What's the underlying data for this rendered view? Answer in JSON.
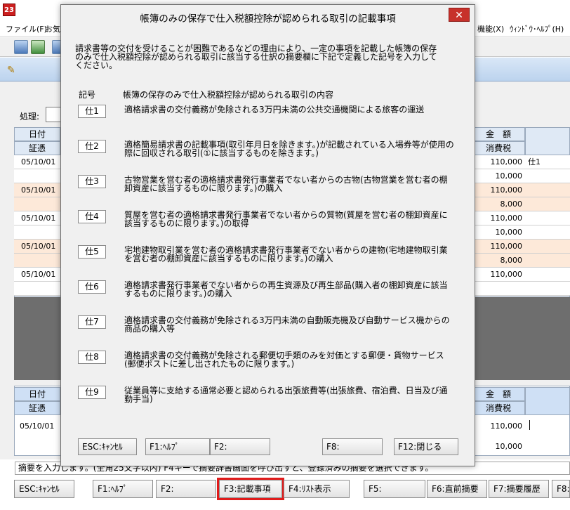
{
  "app": {
    "icon_text": "23",
    "menu": [
      "ファイル(F)",
      "お気",
      "機能(X)",
      "ｳｨﾝﾄﾞｳ･ﾍﾙﾌﾟ(H)"
    ]
  },
  "background": {
    "process_label": "処理:",
    "grid_top": {
      "headers_left": [
        "日付",
        "証憑"
      ],
      "headers_right": [
        "金　額",
        "消費税"
      ],
      "rows": [
        {
          "date": "05/10/01",
          "amount": "110,000",
          "extra": "仕1",
          "style": "white"
        },
        {
          "date": "",
          "amount": "10,000",
          "extra": "",
          "style": "white"
        },
        {
          "date": "05/10/01",
          "amount": "110,000",
          "extra": "",
          "style": "peach"
        },
        {
          "date": "",
          "amount": "8,000",
          "extra": "",
          "style": "peach"
        },
        {
          "date": "05/10/01",
          "amount": "110,000",
          "extra": "",
          "style": "white"
        },
        {
          "date": "",
          "amount": "10,000",
          "extra": "",
          "style": "white"
        },
        {
          "date": "05/10/01",
          "amount": "110,000",
          "extra": "",
          "style": "peach"
        },
        {
          "date": "",
          "amount": "8,000",
          "extra": "",
          "style": "peach"
        },
        {
          "date": "05/10/01",
          "amount": "110,000",
          "extra": "",
          "style": "white"
        },
        {
          "date": "",
          "amount": "",
          "extra": "",
          "style": "white"
        }
      ]
    },
    "grid_bottom": {
      "headers_left": [
        "日付",
        "証憑"
      ],
      "headers_right": [
        "金　額",
        "消費税"
      ],
      "rows": [
        {
          "date": "05/10/01",
          "amount": "110,000"
        },
        {
          "date": "",
          "amount": "10,000"
        }
      ]
    },
    "hint": "摘要を入力します。(全角25文字以内) F4キーで摘要辞書画面を呼び出すと、登録済みの摘要を選択できます。",
    "function_keys": [
      "ESC:ｷｬﾝｾﾙ",
      "F1:ﾍﾙﾌﾟ",
      "F2:",
      "F3:記載事項",
      "F4:ﾘｽﾄ表示",
      "F5:",
      "F6:直前摘要",
      "F7:摘要履歴",
      "F8:"
    ]
  },
  "dialog": {
    "title": "帳簿のみの保存で仕入税額控除が認められる取引の記載事項",
    "close": "✕",
    "intro": "請求書等の交付を受けることが困難であるなどの理由により、一定の事項を記載した帳簿の保存のみで仕入税額控除が認められる取引に該当する仕訳の摘要欄に下記で定義した記号を入力してください。",
    "header_code": "記号",
    "header_content": "帳簿の保存のみで仕入税額控除が認められる取引の内容",
    "rules": [
      {
        "code": "仕1",
        "text": "適格請求書の交付義務が免除される3万円未満の公共交通機関による旅客の運送"
      },
      {
        "code": "仕2",
        "text": "適格簡易請求書の記載事項(取引年月日を除きます。)が記載されている入場券等が使用の際に回収される取引(①に該当するものを除きます。)"
      },
      {
        "code": "仕3",
        "text": "古物営業を営む者の適格請求書発行事業者でない者からの古物(古物営業を営む者の棚卸資産に該当するものに限ります。)の購入"
      },
      {
        "code": "仕4",
        "text": "質屋を営む者の適格請求書発行事業者でない者からの質物(質屋を営む者の棚卸資産に該当するものに限ります。)の取得"
      },
      {
        "code": "仕5",
        "text": "宅地建物取引業を営む者の適格請求書発行事業者でない者からの建物(宅地建物取引業を営む者の棚卸資産に該当するものに限ります。)の購入"
      },
      {
        "code": "仕6",
        "text": "適格請求書発行事業者でない者からの再生資源及び再生部品(購入者の棚卸資産に該当するものに限ります。)の購入"
      },
      {
        "code": "仕7",
        "text": "適格請求書の交付義務が免除される3万円未満の自動販売機及び自動サービス機からの商品の購入等"
      },
      {
        "code": "仕8",
        "text": "適格請求書の交付義務が免除される郵便切手類のみを対価とする郵便・貨物サービス(郵便ポストに差し出されたものに限ります。)"
      },
      {
        "code": "仕9",
        "text": "従業員等に支給する通常必要と認められる出張旅費等(出張旅費、宿泊費、日当及び通勤手当)"
      }
    ],
    "buttons": [
      "ESC:ｷｬﾝｾﾙ",
      "F1:ﾍﾙﾌﾟ",
      "F2:",
      "F8:",
      "F12:閉じる"
    ]
  }
}
